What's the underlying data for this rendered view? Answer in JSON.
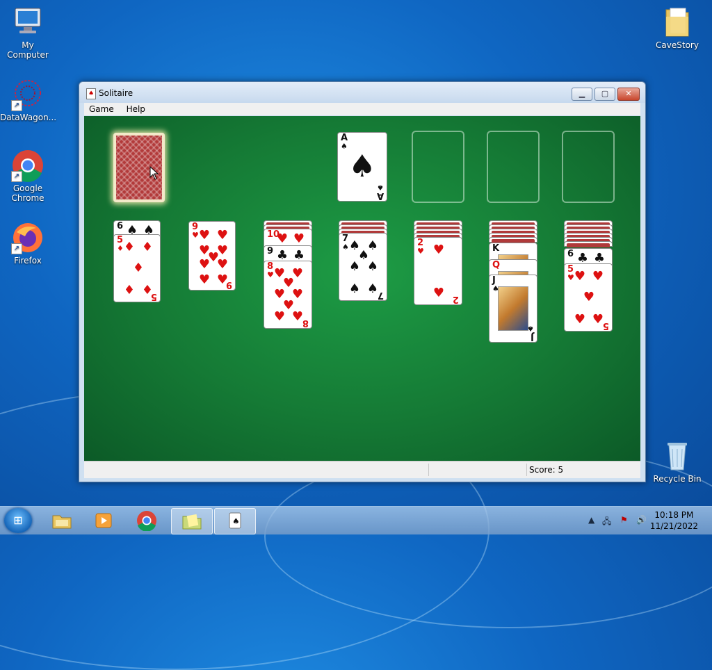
{
  "desktop": {
    "icons": [
      {
        "label": "My Computer"
      },
      {
        "label": "DataWagon..."
      },
      {
        "label": "Google Chrome"
      },
      {
        "label": "Firefox"
      },
      {
        "label": "CaveStory"
      },
      {
        "label": "Recycle Bin"
      }
    ]
  },
  "window": {
    "title": "Solitaire",
    "menu": [
      "Game",
      "Help"
    ],
    "status": {
      "score_label": "Score: 5"
    }
  },
  "game": {
    "stock": "face-down",
    "foundations": [
      {
        "rank": "A",
        "suit": "♠",
        "color": "black"
      },
      {
        "empty": true
      },
      {
        "empty": true
      },
      {
        "empty": true
      }
    ],
    "tableau": [
      {
        "hidden": 0,
        "cards": [
          {
            "rank": "6",
            "suit": "♠"
          },
          {
            "rank": "5",
            "suit": "♦"
          }
        ]
      },
      {
        "hidden": 0,
        "cards": [
          {
            "rank": "9",
            "suit": "♥"
          }
        ]
      },
      {
        "hidden": 2,
        "cards": [
          {
            "rank": "10",
            "suit": "♥"
          },
          {
            "rank": "9",
            "suit": "♣"
          },
          {
            "rank": "8",
            "suit": "♥"
          }
        ]
      },
      {
        "hidden": 3,
        "cards": [
          {
            "rank": "7",
            "suit": "♠"
          }
        ]
      },
      {
        "hidden": 4,
        "cards": [
          {
            "rank": "2",
            "suit": "♥"
          }
        ]
      },
      {
        "hidden": 5,
        "cards": [
          {
            "rank": "K",
            "suit": "♠"
          },
          {
            "rank": "Q",
            "suit": "♥"
          },
          {
            "rank": "J",
            "suit": "♠"
          }
        ]
      },
      {
        "hidden": 6,
        "cards": [
          {
            "rank": "6",
            "suit": "♣"
          },
          {
            "rank": "5",
            "suit": "♥"
          }
        ]
      }
    ]
  },
  "taskbar": {
    "items": [
      "explorer-icon",
      "media-player-icon",
      "chrome-icon",
      "folder-icon",
      "solitaire-icon"
    ],
    "clock": {
      "time": "10:18 PM",
      "date": "11/21/2022"
    }
  },
  "colors": {
    "felt": "#157a35",
    "red_suit": "#d11111",
    "black_suit": "#111111"
  }
}
